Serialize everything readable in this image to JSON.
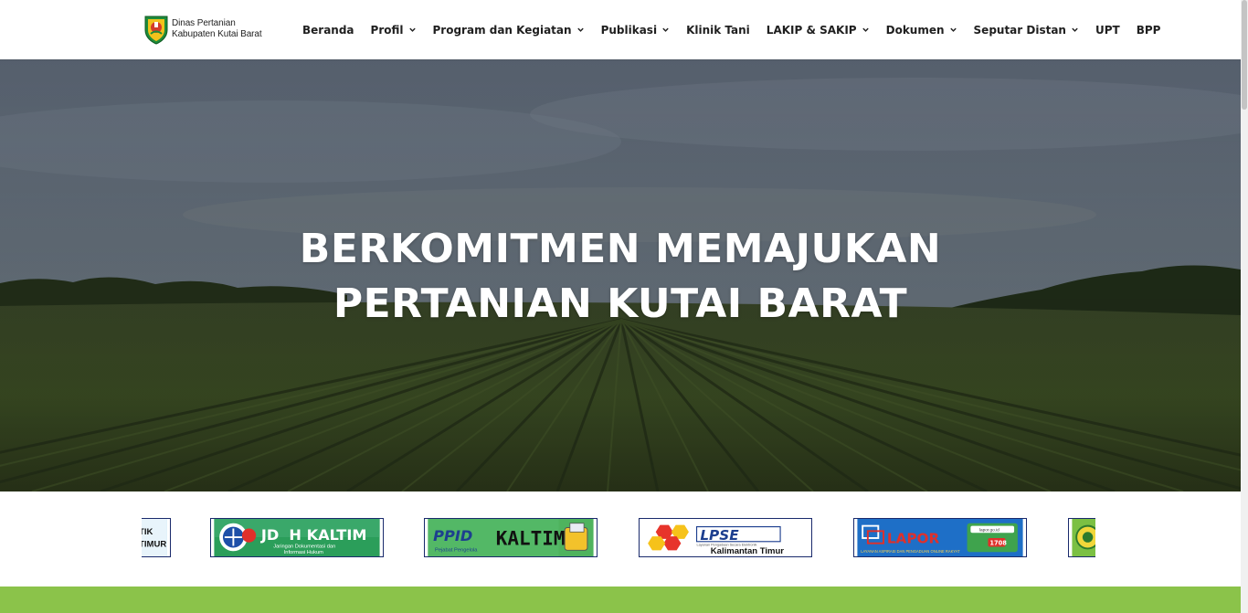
{
  "header": {
    "logo": {
      "line1": "Dinas Pertanian",
      "line2": "Kabupaten Kutai Barat",
      "icon": "kutai-barat-emblem-icon"
    },
    "nav": [
      {
        "label": "Beranda",
        "dropdown": false
      },
      {
        "label": "Profil",
        "dropdown": true
      },
      {
        "label": "Program dan Kegiatan",
        "dropdown": true
      },
      {
        "label": "Publikasi",
        "dropdown": true
      },
      {
        "label": "Klinik Tani",
        "dropdown": false
      },
      {
        "label": "LAKIP & SAKIP",
        "dropdown": true
      },
      {
        "label": "Dokumen",
        "dropdown": true
      },
      {
        "label": "Seputar Distan",
        "dropdown": true
      },
      {
        "label": "UPT",
        "dropdown": false
      },
      {
        "label": "BPP",
        "dropdown": false
      }
    ],
    "dropdown_icon": "chevron-down-icon"
  },
  "hero": {
    "title_line1": "BERKOMITMEN MEMAJUKAN",
    "title_line2": "PERTANIAN KUTAI BARAT",
    "background": "farm-field-photo"
  },
  "partners": {
    "items": [
      {
        "name": "statistik-kaltim",
        "text1": "TIK",
        "text2": "TIMUR"
      },
      {
        "name": "jdih-kaltim",
        "text1": "JD",
        "text2": "H KALTIM",
        "subtitle1": "Jaringan Dokumentasi dan",
        "subtitle2": "Informasi Hukum"
      },
      {
        "name": "ppid-kaltim",
        "text1": "PPID",
        "text2": "KALTIM",
        "subtitle": "Pejabat Pengelola"
      },
      {
        "name": "lpse-kaltim",
        "text1": "LPSE",
        "text2": "Kalimantan Timur",
        "subtitle": "Layanan Pengadaan Secara Elektronik"
      },
      {
        "name": "lapor",
        "text1": "LAPOR",
        "text2": "1708",
        "subtitle": "LAYANAN ASPIRASI DAN PENGADUAN ONLINE RAKYAT",
        "badge": "lapor.go.id"
      },
      {
        "name": "kementan-logo",
        "text1": "",
        "text2": ""
      }
    ]
  },
  "colors": {
    "accent_green": "#8bc34a",
    "nav_text": "#1f1f1f",
    "hero_text": "#ffffff"
  }
}
